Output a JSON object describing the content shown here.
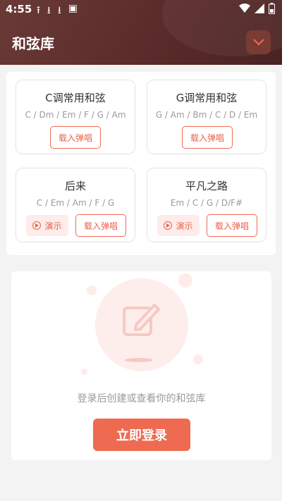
{
  "status_bar": {
    "time": "4:55"
  },
  "header": {
    "title": "和弦库"
  },
  "chord_cards": [
    {
      "title": "C调常用和弦",
      "chords": "C / Dm / Em / F / G / Am",
      "load_label": "载入弹唱"
    },
    {
      "title": "G调常用和弦",
      "chords": "G / Am / Bm / C / D / Em",
      "load_label": "载入弹唱"
    },
    {
      "title": "后来",
      "chords": "C / Em / Am / F / G",
      "demo_label": "演示",
      "load_label": "载入弹唱"
    },
    {
      "title": "平凡之路",
      "chords": "Em / C / G / D/F#",
      "demo_label": "演示",
      "load_label": "载入弹唱"
    }
  ],
  "login": {
    "prompt": "登录后创建或查看你的和弦库",
    "button_label": "立即登录"
  },
  "colors": {
    "header_bg": "#5a2b2a",
    "accent": "#ee6b52"
  }
}
